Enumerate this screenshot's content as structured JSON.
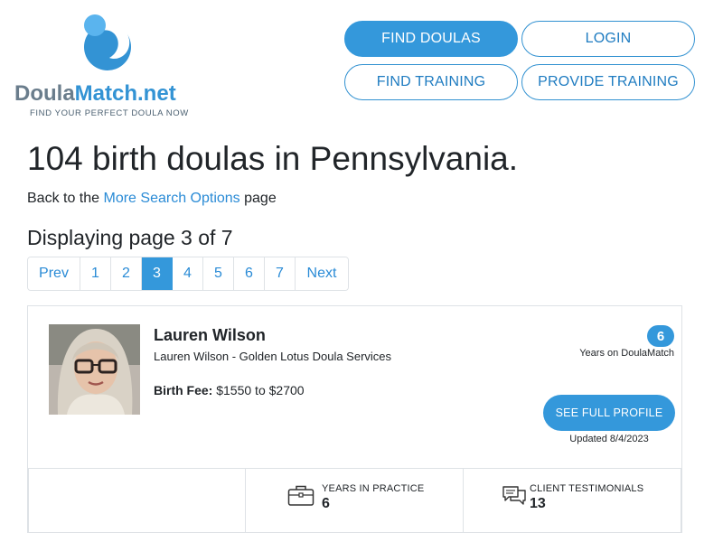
{
  "logo": {
    "word_part1": "Doula",
    "word_part2": "Match.net",
    "tagline": "FIND YOUR PERFECT DOULA NOW",
    "colors": {
      "gray": "#6a7d8c",
      "blue": "#3393d4",
      "light_blue": "#5ab4ee"
    }
  },
  "nav": {
    "find_doulas": "FIND DOULAS",
    "login": "LOGIN",
    "find_training": "FIND TRAINING",
    "provide_training": "PROVIDE TRAINING"
  },
  "heading": {
    "title": "104 birth doulas in Pennsylvania.",
    "back_prefix": "Back to the ",
    "back_link": "More Search Options",
    "back_suffix": " page",
    "paging": "Displaying page 3 of 7"
  },
  "pagination": {
    "prev": "Prev",
    "pages": [
      "1",
      "2",
      "3",
      "4",
      "5",
      "6",
      "7"
    ],
    "current_page": "3",
    "next": "Next"
  },
  "doula": {
    "name": "Lauren Wilson",
    "business": "Lauren Wilson - Golden Lotus Doula Services",
    "fee_label": "Birth Fee:",
    "fee_value": "$1550 to $2700",
    "years_on_site": "6",
    "years_on_site_label": "Years on DoulaMatch",
    "profile_button": "SEE FULL PROFILE",
    "updated": "Updated 8/4/2023",
    "stats": {
      "years_practice_label": "YEARS IN PRACTICE",
      "years_practice_value": "6",
      "testimonials_label": "CLIENT TESTIMONIALS",
      "testimonials_value": "13"
    }
  },
  "colors": {
    "accent": "#3498db",
    "link": "#2a8bd6",
    "border": "#dee2e6",
    "text": "#212529"
  },
  "icons": {
    "logo_mark": "doula-logo-icon",
    "years_practice": "briefcase-icon",
    "testimonials": "chat-bubbles-icon"
  }
}
